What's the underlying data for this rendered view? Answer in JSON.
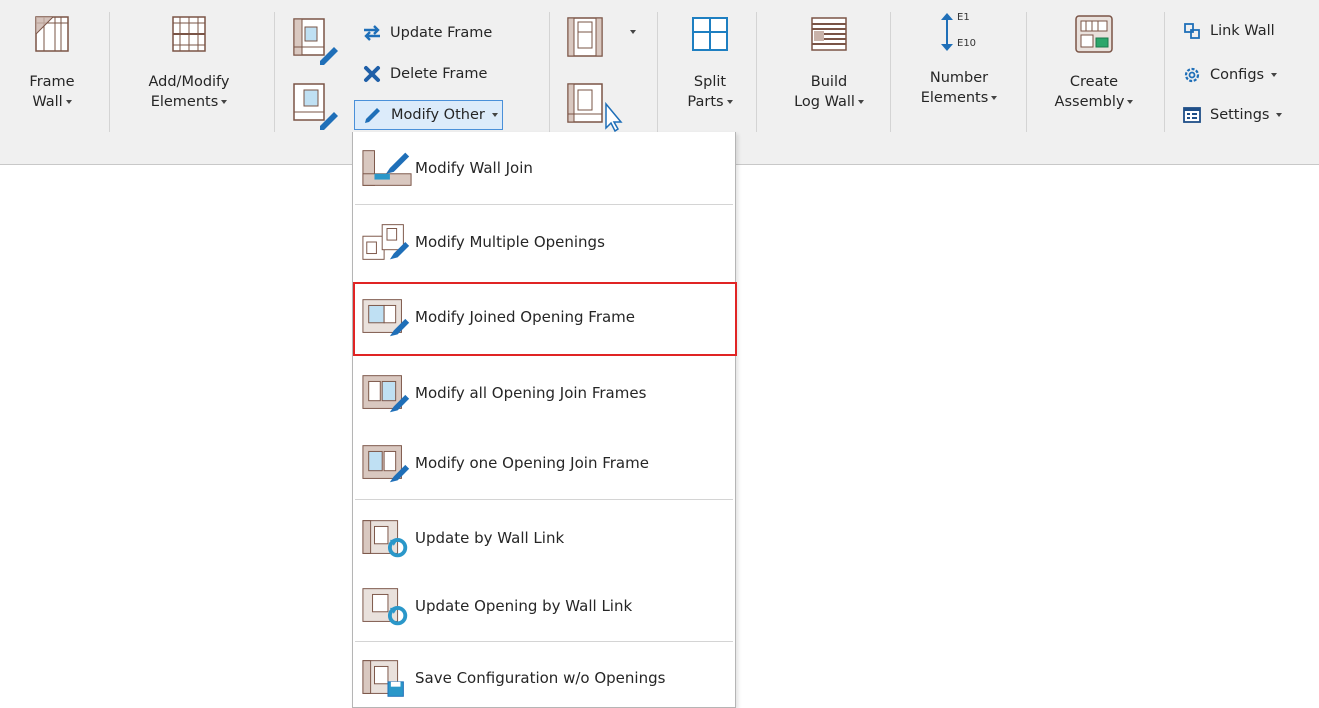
{
  "ribbon": {
    "frame_wall": {
      "line1": "Frame",
      "line2": "Wall"
    },
    "add_modify": {
      "line1": "Add/Modify",
      "line2": "Elements"
    },
    "update_frame": "Update Frame",
    "delete_frame": "Delete Frame",
    "modify_other": "Modify Other",
    "split_parts": {
      "line1": "Split",
      "line2": "Parts"
    },
    "build_log_wall": {
      "line1": "Build",
      "line2": "Log Wall"
    },
    "number_elements": {
      "line1": "Number",
      "line2": "Elements",
      "icon_top": "E1",
      "icon_bottom": "E10"
    },
    "create_assembly": {
      "line1": "Create",
      "line2": "Assembly"
    },
    "link_wall": "Link Wall",
    "configs": "Configs",
    "settings": "Settings"
  },
  "menu": {
    "items": [
      {
        "label": "Modify Wall Join",
        "icon": "wall-join-icon"
      },
      {
        "label": "Modify Multiple Openings",
        "icon": "multiple-openings-icon"
      },
      {
        "label": "Modify Joined Opening Frame",
        "icon": "joined-opening-frame-icon",
        "highlighted": true
      },
      {
        "label": "Modify all Opening Join Frames",
        "icon": "all-join-frames-icon"
      },
      {
        "label": "Modify one Opening Join Frame",
        "icon": "one-join-frame-icon"
      },
      {
        "label": "Update by Wall Link",
        "icon": "update-wall-link-icon"
      },
      {
        "label": "Update Opening by Wall Link",
        "icon": "update-opening-wall-link-icon"
      },
      {
        "label": "Save Configuration w/o Openings",
        "icon": "save-config-icon"
      }
    ]
  },
  "colors": {
    "accent_blue": "#1e7fc1",
    "wall_brown": "#8a5a4a",
    "highlight_red": "#e02424",
    "pencil_blue": "#1f6fb8"
  }
}
